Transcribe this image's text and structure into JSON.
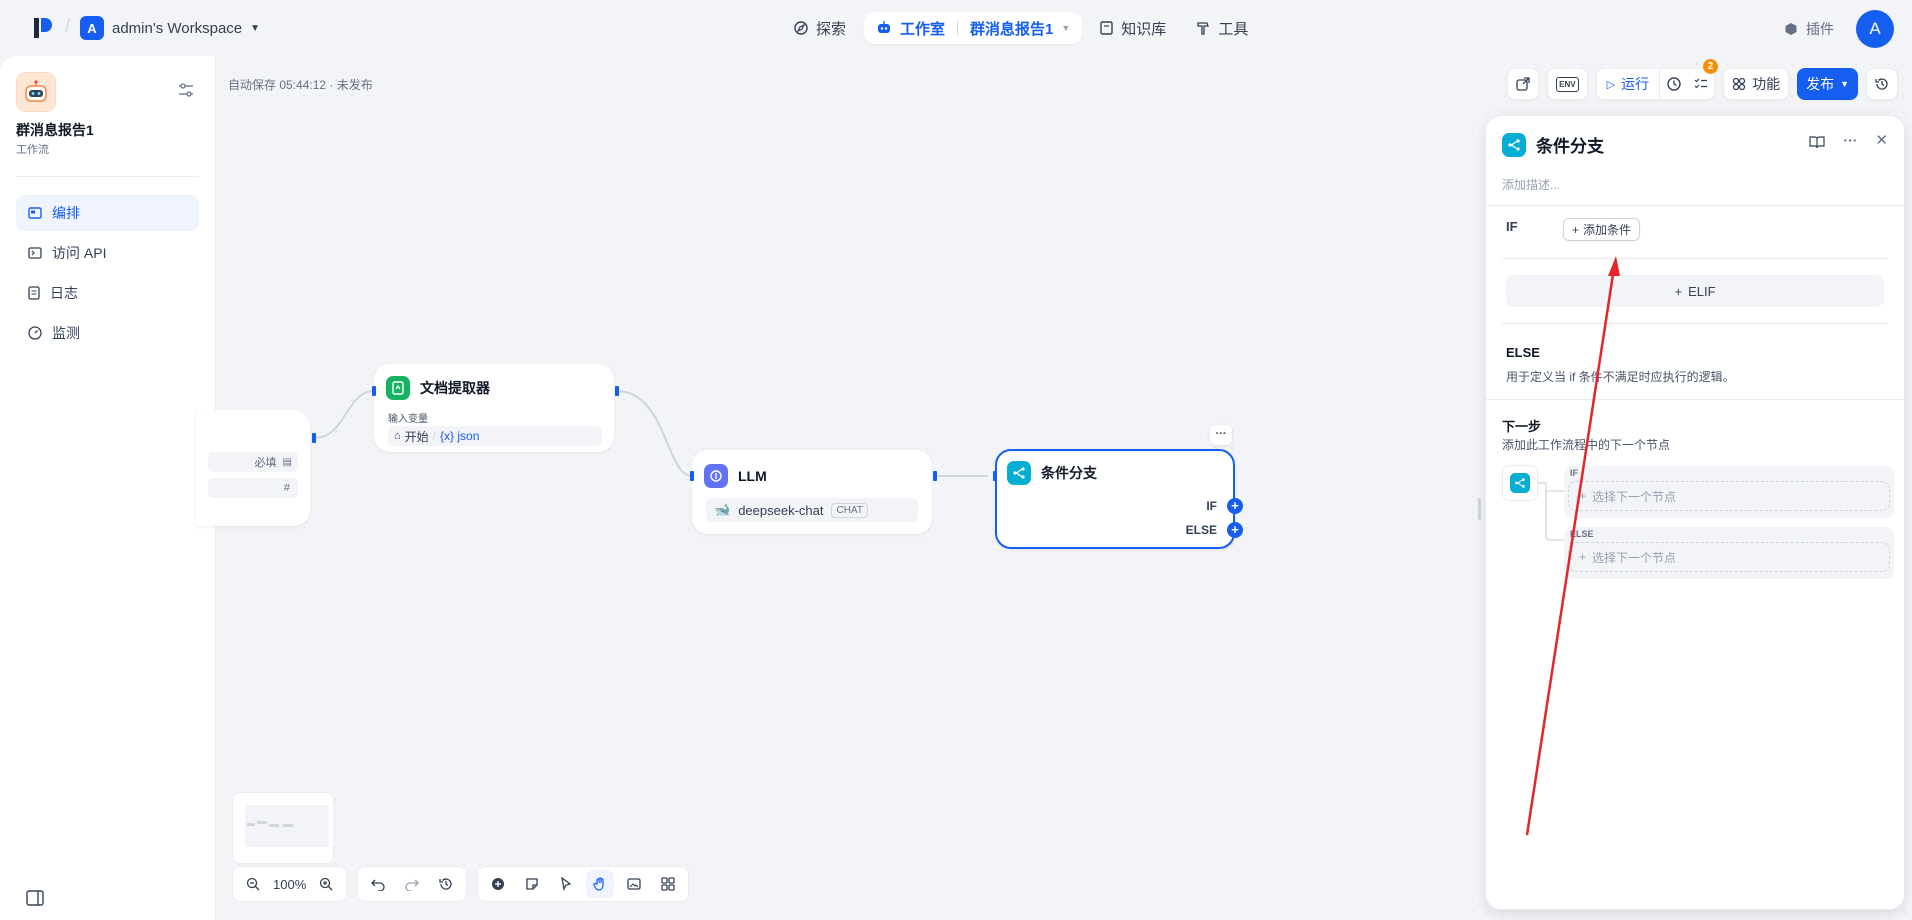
{
  "topbar": {
    "workspace_avatar": "A",
    "workspace_name": "admin's Workspace",
    "nav": {
      "explore": "探索",
      "studio": "工作室",
      "current_app": "群消息报告1",
      "knowledge": "知识库",
      "tools": "工具"
    },
    "plugins": "插件",
    "user_avatar": "A"
  },
  "sidebar": {
    "app_name": "群消息报告1",
    "app_type": "工作流",
    "items": [
      {
        "label": "编排",
        "icon": "orchestrate-icon"
      },
      {
        "label": "访问 API",
        "icon": "terminal-icon"
      },
      {
        "label": "日志",
        "icon": "log-icon"
      },
      {
        "label": "监测",
        "icon": "monitor-icon"
      }
    ]
  },
  "canvas": {
    "autosave": "自动保存 05:44:12 · 未发布",
    "toolbar": {
      "env": "ENV",
      "run": "运行",
      "checklist_count": "2",
      "features": "功能",
      "publish": "发布"
    },
    "start_node": {
      "required": "必填",
      "hash": "#"
    },
    "doc_node": {
      "title": "文档提取器",
      "input_label": "输入变量",
      "source": "开始",
      "var": "{x} json"
    },
    "llm_node": {
      "title": "LLM",
      "model": "deepseek-chat",
      "mode": "CHAT"
    },
    "if_node": {
      "title": "条件分支",
      "if": "IF",
      "else": "ELSE",
      "more": "···"
    },
    "zoom": "100%"
  },
  "panel": {
    "title": "条件分支",
    "desc_placeholder": "添加描述...",
    "if_label": "IF",
    "add_condition": "添加条件",
    "elif": "ELIF",
    "else_label": "ELSE",
    "else_desc": "用于定义当 if 条件不满足时应执行的逻辑。",
    "next_title": "下一步",
    "next_desc": "添加此工作流程中的下一个节点",
    "branch_if": "IF",
    "branch_else": "ELSE",
    "select_next": "选择下一个节点"
  },
  "colors": {
    "accent": "#155eef",
    "annotation_arrow": "#e5242b",
    "if_else_icon": "#06aed4",
    "doc_icon": "#16b364",
    "llm_icon": "#6172f3"
  }
}
